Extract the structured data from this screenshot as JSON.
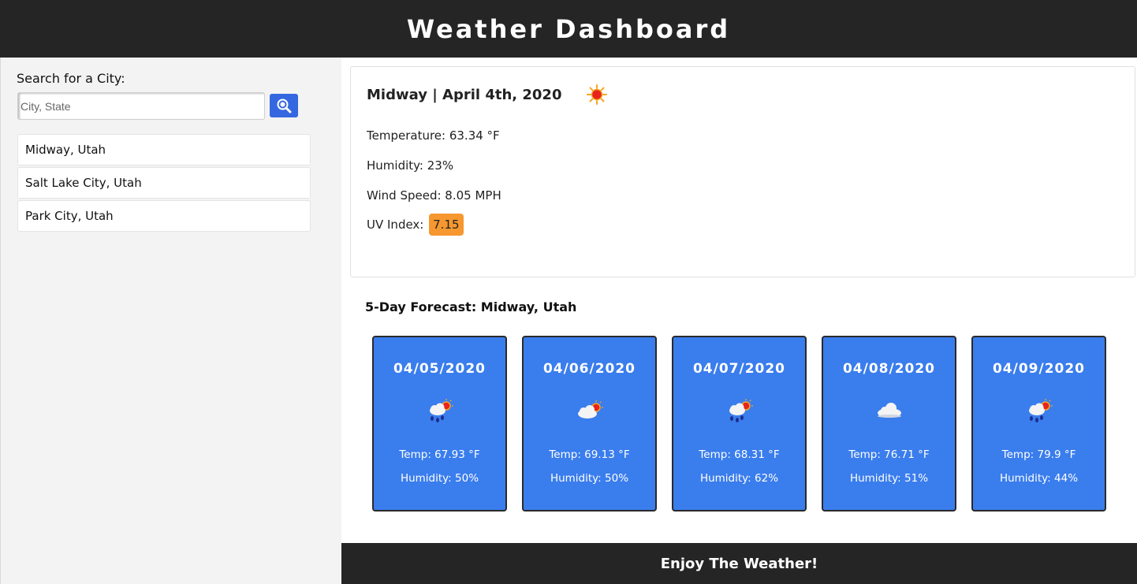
{
  "header": {
    "title": "Weather Dashboard"
  },
  "search": {
    "label": "Search for a City:",
    "placeholder": "City, State",
    "value": "",
    "button_icon": "search-icon"
  },
  "history": [
    "Midway, Utah",
    "Salt Lake City, Utah",
    "Park City, Utah"
  ],
  "current": {
    "title": "Midway | April 4th, 2020",
    "icon": "sun-icon",
    "temperature": "Temperature: 63.34 °F",
    "humidity": "Humidity: 23%",
    "wind": "Wind Speed: 8.05 MPH",
    "uv_label": "UV Index:",
    "uv_value": "7.15",
    "uv_color": "#f6972f"
  },
  "forecast": {
    "title": "5-Day Forecast: Midway, Utah",
    "days": [
      {
        "date": "04/05/2020",
        "icon": "rain-sun-icon",
        "temp": "Temp: 67.93 °F",
        "humidity": "Humidity: 50%"
      },
      {
        "date": "04/06/2020",
        "icon": "cloud-sun-icon",
        "temp": "Temp: 69.13 °F",
        "humidity": "Humidity: 50%"
      },
      {
        "date": "04/07/2020",
        "icon": "rain-sun-icon",
        "temp": "Temp: 68.31 °F",
        "humidity": "Humidity: 62%"
      },
      {
        "date": "04/08/2020",
        "icon": "cloud-icon",
        "temp": "Temp: 76.71 °F",
        "humidity": "Humidity: 51%"
      },
      {
        "date": "04/09/2020",
        "icon": "rain-sun-icon",
        "temp": "Temp: 79.9 °F",
        "humidity": "Humidity: 44%"
      }
    ]
  },
  "footer": {
    "text": "Enjoy The Weather!"
  },
  "colors": {
    "header_bg": "#252525",
    "card_bg": "#3a7ded",
    "button_bg": "#3567e0",
    "sidebar_bg": "#f3f3f3"
  }
}
